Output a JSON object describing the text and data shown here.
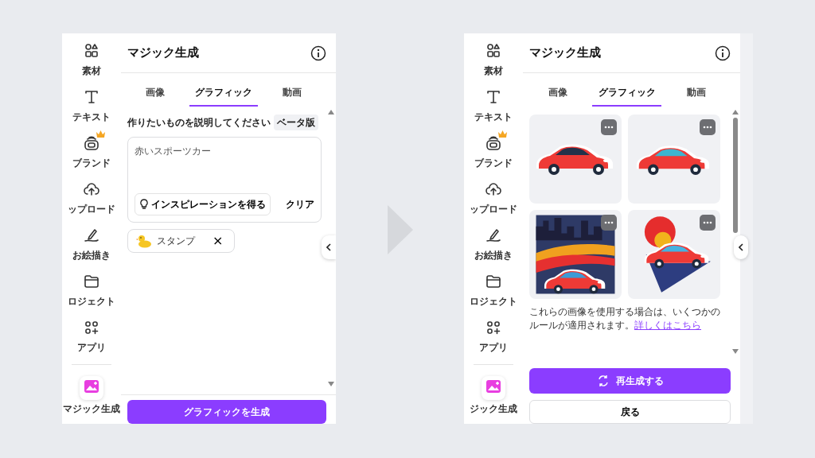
{
  "panels": [
    {
      "kind": "form",
      "title": "マジック生成",
      "sidebar": [
        {
          "label": "素材",
          "selected": false,
          "premium": false
        },
        {
          "label": "テキスト",
          "selected": false,
          "premium": false
        },
        {
          "label": "ブランド",
          "selected": false,
          "premium": true
        },
        {
          "label": "ップロード",
          "selected": false,
          "premium": false
        },
        {
          "label": "お絵描き",
          "selected": false,
          "premium": false
        },
        {
          "label": "ロジェクト",
          "selected": false,
          "premium": false
        },
        {
          "label": "アプリ",
          "selected": false,
          "premium": false
        },
        {
          "label": "マジック生成",
          "selected": true,
          "premium": false
        }
      ],
      "tabs": [
        {
          "label": "画像",
          "selected": false
        },
        {
          "label": "グラフィック",
          "selected": true
        },
        {
          "label": "動画",
          "selected": false
        }
      ],
      "prompt_label": "作りたいものを説明してください",
      "badge": "ベータ版",
      "prompt": "赤いスポーツカー",
      "inspire_button": "インスピレーションを得る",
      "clear_button": "クリア",
      "style_chip": {
        "label": "スタンプ",
        "remove": "×"
      },
      "generate_button": "グラフィックを生成"
    },
    {
      "kind": "results",
      "title": "マジック生成",
      "sidebar": [
        {
          "label": "素材",
          "selected": false,
          "premium": false
        },
        {
          "label": "テキスト",
          "selected": false,
          "premium": false
        },
        {
          "label": "ブランド",
          "selected": false,
          "premium": true
        },
        {
          "label": "ップロード",
          "selected": false,
          "premium": false
        },
        {
          "label": "お絵描き",
          "selected": false,
          "premium": false
        },
        {
          "label": "ロジェクト",
          "selected": false,
          "premium": false
        },
        {
          "label": "アプリ",
          "selected": false,
          "premium": false
        },
        {
          "label": "ジック生成",
          "selected": true,
          "premium": false
        }
      ],
      "tabs": [
        {
          "label": "画像",
          "selected": false
        },
        {
          "label": "グラフィック",
          "selected": true
        },
        {
          "label": "動画",
          "selected": false
        }
      ],
      "images": [
        {
          "kind": "car"
        },
        {
          "kind": "car2"
        },
        {
          "kind": "city"
        },
        {
          "kind": "sunset"
        }
      ],
      "notice": "これらの画像を使用する場合は、いくつかのルールが適用されます。",
      "notice_link": "詳しくはこちら",
      "regenerate_button": "再生成する",
      "back_button": "戻る"
    }
  ]
}
